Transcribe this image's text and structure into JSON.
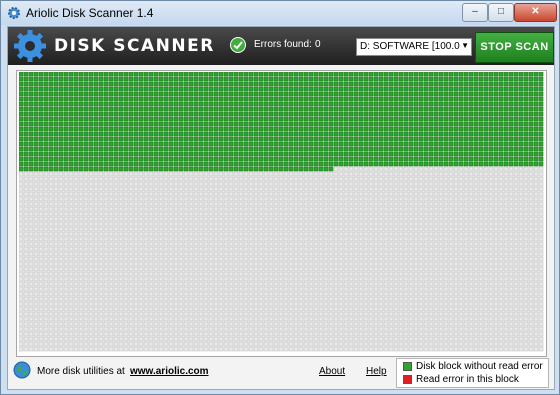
{
  "window": {
    "title": "Ariolic Disk Scanner 1.4",
    "minimize": "–",
    "maximize": "□",
    "close": "✕"
  },
  "header": {
    "app_name": "DISK SCANNER",
    "errors_label": "Errors found:",
    "errors_value": "0",
    "drive_selected": "D: SOFTWARE [100.0",
    "stop_button": "STOP SCAN"
  },
  "scan": {
    "scanned_fraction": 0.35,
    "colors": {
      "ok": "#2ea52e",
      "pending": "#e9e9e9",
      "error": "#e02020"
    }
  },
  "footer": {
    "more_text": "More disk utilities at",
    "site_link": "www.ariolic.com",
    "about": "About",
    "help": "Help"
  },
  "legend": {
    "ok_label": "Disk block without read error",
    "error_label": "Read error in this block",
    "ok_color": "#2ea52e",
    "error_color": "#e02020"
  },
  "icons": {
    "app": "gear-icon",
    "status": "check-icon",
    "footer": "globe-icon"
  }
}
